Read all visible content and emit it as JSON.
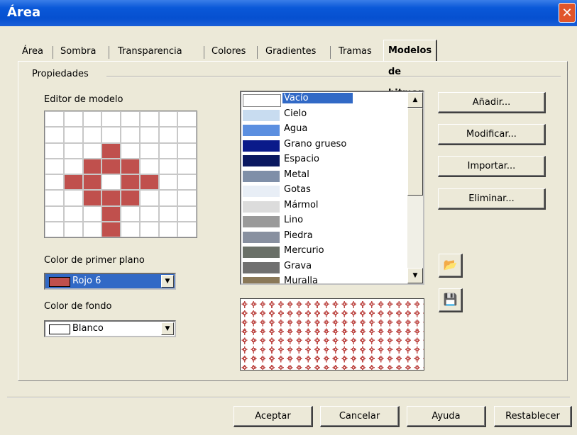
{
  "window": {
    "title": "Área",
    "close_icon": "close-icon"
  },
  "tabs": [
    {
      "label": "Área",
      "active": false
    },
    {
      "label": "Sombra",
      "active": false
    },
    {
      "label": "Transparencia",
      "active": false
    },
    {
      "label": "Colores",
      "active": false
    },
    {
      "label": "Gradientes",
      "active": false
    },
    {
      "label": "Tramas",
      "active": false
    },
    {
      "label": "Modelos de bitmap",
      "active": true
    }
  ],
  "group": {
    "label": "Propiedades"
  },
  "editor": {
    "label": "Editor de modelo",
    "pattern": [
      [
        0,
        0,
        0,
        0,
        0,
        0,
        0,
        0
      ],
      [
        0,
        0,
        0,
        0,
        0,
        0,
        0,
        0
      ],
      [
        0,
        0,
        0,
        1,
        0,
        0,
        0,
        0
      ],
      [
        0,
        0,
        1,
        1,
        1,
        0,
        0,
        0
      ],
      [
        0,
        1,
        1,
        0,
        1,
        1,
        0,
        0
      ],
      [
        0,
        0,
        1,
        1,
        1,
        0,
        0,
        0
      ],
      [
        0,
        0,
        0,
        1,
        0,
        0,
        0,
        0
      ],
      [
        0,
        0,
        0,
        1,
        0,
        0,
        0,
        0
      ]
    ],
    "on_color": "#c0504d",
    "off_color": "#ffffff"
  },
  "foreground": {
    "label": "Color de primer plano",
    "value": "Rojo 6",
    "swatch": "#c0504d"
  },
  "background": {
    "label": "Color de fondo",
    "value": "Blanco",
    "swatch": "#ffffff"
  },
  "bitmaps": {
    "items": [
      {
        "name": "Vacío",
        "swatch": "#ffffff",
        "selected": true
      },
      {
        "name": "Cielo",
        "swatch": "#c8dcf0",
        "selected": false
      },
      {
        "name": "Agua",
        "swatch": "#5b8fe0",
        "selected": false
      },
      {
        "name": "Grano grueso",
        "swatch": "#0a1a8a",
        "selected": false
      },
      {
        "name": "Espacio",
        "swatch": "#0a1860",
        "selected": false
      },
      {
        "name": "Metal",
        "swatch": "#7f8fa8",
        "selected": false
      },
      {
        "name": "Gotas",
        "swatch": "#e8eef6",
        "selected": false
      },
      {
        "name": "Mármol",
        "swatch": "#dcdcdc",
        "selected": false
      },
      {
        "name": "Lino",
        "swatch": "#9a9a9a",
        "selected": false
      },
      {
        "name": "Piedra",
        "swatch": "#8890a0",
        "selected": false
      },
      {
        "name": "Mercurio",
        "swatch": "#6a7068",
        "selected": false
      },
      {
        "name": "Grava",
        "swatch": "#707070",
        "selected": false
      },
      {
        "name": "Muralla",
        "swatch": "#8a7858",
        "selected": false
      }
    ]
  },
  "buttons": {
    "add": "Añadir...",
    "modify": "Modificar...",
    "import": "Importar...",
    "delete": "Eliminar..."
  },
  "icons": {
    "open": "open-folder-icon",
    "save": "save-disk-icon"
  },
  "footer": {
    "ok": "Aceptar",
    "cancel": "Cancelar",
    "help": "Ayuda",
    "reset": "Restablecer"
  }
}
